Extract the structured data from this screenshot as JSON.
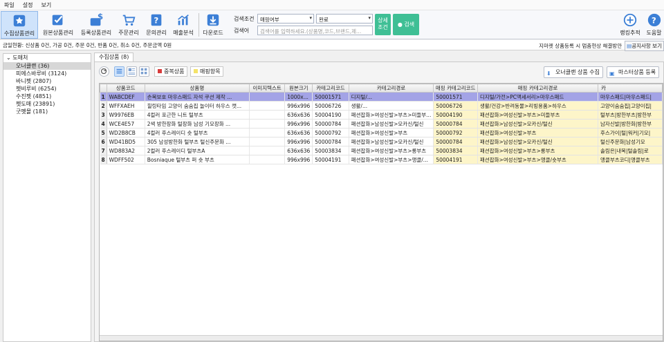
{
  "menu": [
    "파일",
    "설정",
    "보기"
  ],
  "toolbar": {
    "buttons": [
      {
        "label": "수집상품관리",
        "icon": "star-icon"
      },
      {
        "label": "원본상품관리",
        "icon": "checkbox-icon"
      },
      {
        "label": "등록상품관리",
        "icon": "dollar-icon"
      },
      {
        "label": "주문관리",
        "icon": "cart-icon"
      },
      {
        "label": "문의관리",
        "icon": "question-icon"
      },
      {
        "label": "매출분석",
        "icon": "chart-icon"
      },
      {
        "label": "다운로드",
        "icon": "download-icon"
      }
    ],
    "right_buttons": [
      {
        "label": "랭킹추적",
        "icon": "plus-circle-icon"
      },
      {
        "label": "도움말",
        "icon": "help-icon"
      }
    ]
  },
  "search": {
    "condition_label": "검색조건",
    "condition_value": "매핑여부",
    "status_value": "완료",
    "keyword_label": "검색어",
    "keyword_placeholder": "검색어를 입력하세요.(상품명,코드,브랜드,제...",
    "detail_label_1": "상세",
    "detail_label_2": "조건",
    "search_label": "검색"
  },
  "status": {
    "info": "금일현황: 신상품 0건, 가공 0건, 주문 0건, 반품 0건, 취소 0건, 주문금액 0원",
    "notice": "지마켓 상품등록 시 멈춤현상 해결방안",
    "notice_btn": "공지사항 보기"
  },
  "left_panel": {
    "header": "도매처",
    "items": [
      "오너클랜 (36)",
      "피에스바루비 (3124)",
      "바니펫 (2807)",
      "펫비루비 (6254)",
      "수진펫 (4851)",
      "펫도매 (23891)",
      "굿펫몰 (181)"
    ]
  },
  "tab_label": "수집상품 (8)",
  "subbar": {
    "dup_label": "중복상품",
    "mapping_label": "매핑항목",
    "collect_label": "오너클랜 상품 수집",
    "master_label": "마스터상품 등록"
  },
  "table": {
    "headers": [
      "상품코드",
      "상품명",
      "이미지텍스트",
      "원본크기",
      "카테고리코드",
      "카테고리경로",
      "매핑 카테고리코드",
      "매핑 카테고리경로",
      "카"
    ],
    "rows": [
      {
        "n": "1",
        "code": "WABCDEF",
        "name": "손목보호 마우스패드 자석 쿠션 제작 ...",
        "img": "",
        "size": "1000x...",
        "cat": "50001571",
        "path": "디지털/...",
        "mcode": "50001571",
        "mpath": "디지털/가전>PC액세서리>마우스패드",
        "extra": "마우스패드|마우스패드|"
      },
      {
        "n": "2",
        "code": "WFFXAEH",
        "name": "힐링타임 고양이 숨숨집 놀이터 하우스 캣...",
        "img": "",
        "size": "996x996",
        "cat": "50006726",
        "path": "생활/...",
        "mcode": "50006726",
        "mpath": "생활/건강>반려동물>리빙용품>하우스",
        "extra": "고양이숨숨집|고양이집|"
      },
      {
        "n": "3",
        "code": "W9976EB",
        "name": "4컬러 포근한 니트 털부츠",
        "img": "",
        "size": "636x636",
        "cat": "50004190",
        "path": "패션잡화>여성신발>부츠>미들부...",
        "mcode": "50004190",
        "mpath": "패션잡화>여성신발>부츠>미들부츠",
        "extra": "털부츠|방한부츠|방한부"
      },
      {
        "n": "4",
        "code": "WCE4E57",
        "name": "2색 방한장화 털장화 남성 기모장화 ...",
        "img": "",
        "size": "996x996",
        "cat": "50000784",
        "path": "패션잡화>남성신발>모카신/털신",
        "mcode": "50000784",
        "mpath": "패션잡화>남성신발>모카신/털신",
        "extra": "남자신발|방한화|방한부"
      },
      {
        "n": "5",
        "code": "WD2B8CB",
        "name": "4컬러 후스레이디 숏 털부츠",
        "img": "",
        "size": "636x636",
        "cat": "50000792",
        "path": "패션잡화>여성신발>부츠",
        "mcode": "50000792",
        "mpath": "패션잡화>여성신발>부츠",
        "extra": "후스가이|털|워커|기모|"
      },
      {
        "n": "6",
        "code": "WD41BD5",
        "name": "305 남성방한화 털부츠 털신주문화 ...",
        "img": "",
        "size": "996x996",
        "cat": "50000784",
        "path": "패션잡화>남성신발>모카신/털신",
        "mcode": "50000784",
        "mpath": "패션잡화>남성신발>모카신/털신",
        "extra": "털신주문화|남성기모"
      },
      {
        "n": "7",
        "code": "WD883A2",
        "name": "2컬러 후스레이디 털부츠A",
        "img": "",
        "size": "636x636",
        "cat": "50003834",
        "path": "패션잡화>여성신발>부츠>롱부츠",
        "mcode": "50003834",
        "mpath": "패션잡화>여성신발>부츠>롱부츠",
        "extra": "솔림은|내복|털솔림|로"
      },
      {
        "n": "8",
        "code": "WDFF502",
        "name": "Bosniaque 털부츠 퍼 숏 부츠",
        "img": "",
        "size": "996x996",
        "cat": "50004191",
        "path": "패션잡화>여성신발>부츠>앵클/...",
        "mcode": "50004191",
        "mpath": "패션잡화>여성신발>부츠>앵클/숏부츠",
        "extra": "앵클부츠코디|앵클부츠"
      }
    ]
  }
}
